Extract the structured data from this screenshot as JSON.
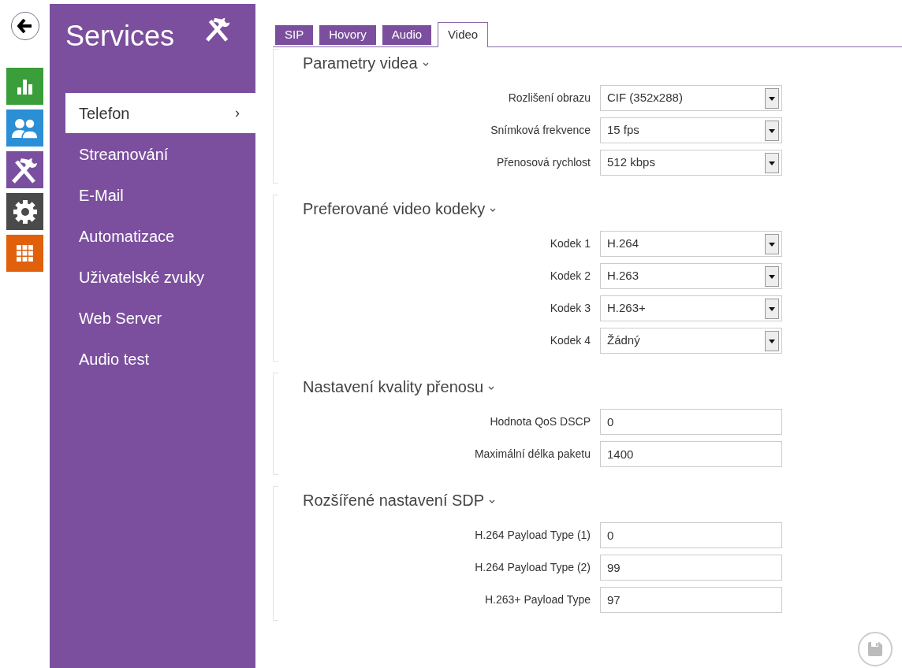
{
  "nav_icons": [
    {
      "kind": "back"
    },
    {
      "kind": "chart",
      "color": "#3a9e3a"
    },
    {
      "kind": "users",
      "color": "#2b8fd6"
    },
    {
      "kind": "tools",
      "color": "#7b4fa0"
    },
    {
      "kind": "gear",
      "color": "#4a4a4a"
    },
    {
      "kind": "grid",
      "color": "#e0600c"
    }
  ],
  "sidebar": {
    "title": "Services",
    "items": [
      {
        "label": "Telefon",
        "selected": true,
        "chevron": "›"
      },
      {
        "label": "Streamování",
        "selected": false
      },
      {
        "label": "E-Mail",
        "selected": false
      },
      {
        "label": "Automatizace",
        "selected": false
      },
      {
        "label": "Uživatelské zvuky",
        "selected": false
      },
      {
        "label": "Web Server",
        "selected": false
      },
      {
        "label": "Audio test",
        "selected": false
      }
    ]
  },
  "tabs": [
    {
      "label": "SIP",
      "selected": false
    },
    {
      "label": "Hovory",
      "selected": false
    },
    {
      "label": "Audio",
      "selected": false
    },
    {
      "label": "Video",
      "selected": true
    }
  ],
  "sections": [
    {
      "title": "Parametry videa",
      "fields": [
        {
          "kind": "select",
          "label": "Rozlišení obrazu",
          "value": "CIF (352x288)"
        },
        {
          "kind": "select",
          "label": "Snímková frekvence",
          "value": "15 fps"
        },
        {
          "kind": "select",
          "label": "Přenosová rychlost",
          "value": "512 kbps"
        }
      ]
    },
    {
      "title": "Preferované video kodeky",
      "fields": [
        {
          "kind": "select",
          "label": "Kodek 1",
          "value": "H.264"
        },
        {
          "kind": "select",
          "label": "Kodek 2",
          "value": "H.263"
        },
        {
          "kind": "select",
          "label": "Kodek 3",
          "value": "H.263+"
        },
        {
          "kind": "select",
          "label": "Kodek 4",
          "value": "Žádný"
        }
      ]
    },
    {
      "title": "Nastavení kvality přenosu",
      "fields": [
        {
          "kind": "input",
          "label": "Hodnota QoS DSCP",
          "value": "0"
        },
        {
          "kind": "input",
          "label": "Maximální délka paketu",
          "value": "1400"
        }
      ]
    },
    {
      "title": "Rozšířené nastavení SDP",
      "fields": [
        {
          "kind": "input",
          "label": "H.264 Payload Type (1)",
          "value": "0"
        },
        {
          "kind": "input",
          "label": "H.264 Payload Type (2)",
          "value": "99"
        },
        {
          "kind": "input",
          "label": "H.263+ Payload Type",
          "value": "97"
        }
      ]
    }
  ]
}
